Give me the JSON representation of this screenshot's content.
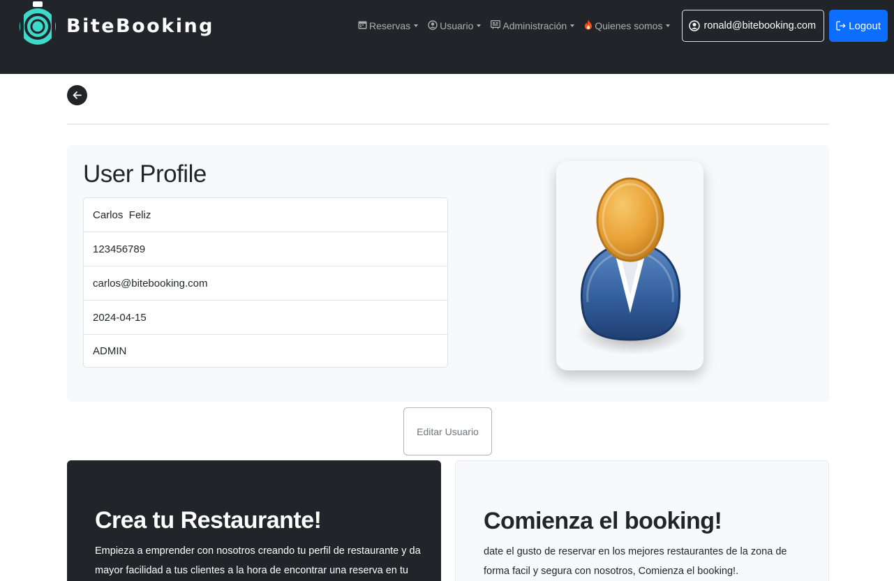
{
  "navbar": {
    "brand": "BiteBooking",
    "menu": [
      {
        "label": "Reservas",
        "icon": "calendar-icon"
      },
      {
        "label": "Usuario",
        "icon": "user-circle-icon"
      },
      {
        "label": "Administración",
        "icon": "admin-panel-icon"
      },
      {
        "label": "Quienes somos",
        "icon": "fire-icon"
      }
    ],
    "user_email": "ronald@bitebooking.com",
    "logout_label": "Logout"
  },
  "profile": {
    "title": "User Profile",
    "name": "Carlos  Feliz",
    "phone": "123456789",
    "email": "carlos@bitebooking.com",
    "date": "2024-04-15",
    "role": "ADMIN",
    "edit_label": "Editar Usuario"
  },
  "cards": {
    "restaurant": {
      "title": "Crea tu Restaurante!",
      "text": "Empieza a emprender con nosotros creando tu perfil de restaurante y da mayor facilidad a tus clientes a la hora de encontrar una reserva en tu local,"
    },
    "booking": {
      "title": "Comienza el booking!",
      "text": "date el gusto de reservar en los mejores restaurantes de la zona de forma facil y segura con nosotros, Comienza el booking!."
    }
  },
  "colors": {
    "navbar_bg": "#212529",
    "primary": "#0d6efd",
    "avatar_head": "#e5a032",
    "avatar_body": "#2f5f9e",
    "fire": "#fd7e14"
  }
}
